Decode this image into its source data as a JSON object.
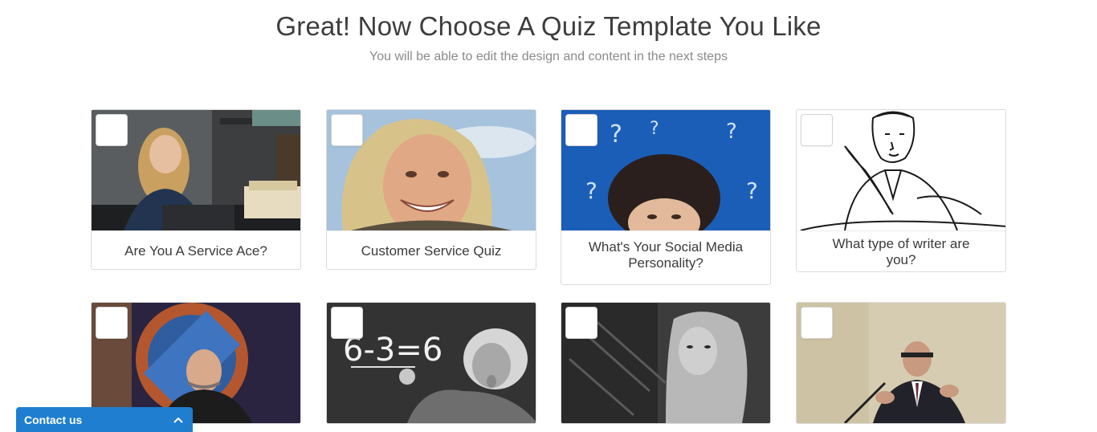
{
  "header": {
    "title": "Great! Now Choose A Quiz Template You Like",
    "subtitle": "You will be able to edit the design and content in the next steps"
  },
  "templates": [
    {
      "title": "Are You A Service Ace?",
      "image": "woman-at-office-desk"
    },
    {
      "title": "Customer Service Quiz",
      "image": "smiling-man-portrait"
    },
    {
      "title": "What's Your Social Media Personality?",
      "image": "woman-looking-up-chalkboard"
    },
    {
      "title": "What type of writer are you?",
      "image": "sketch-writer-with-quill"
    },
    {
      "title": "",
      "image": "tv-host-on-set"
    },
    {
      "title": "",
      "image": "einstein-at-chalkboard"
    },
    {
      "title": "",
      "image": "woman-black-and-white"
    },
    {
      "title": "",
      "image": "speaker-at-podium"
    }
  ],
  "contact": {
    "label": "Contact us",
    "icon": "chevron-up-icon"
  },
  "colors": {
    "accent": "#1f7ed0"
  }
}
